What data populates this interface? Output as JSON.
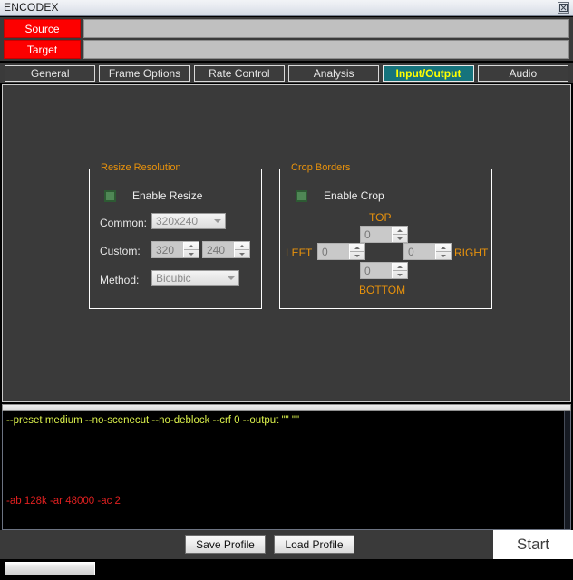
{
  "window": {
    "title": "ENCODEX",
    "close_icon": "close-icon"
  },
  "io": {
    "source_label": "Source",
    "source_value": "",
    "target_label": "Target",
    "target_value": ""
  },
  "tabs": [
    {
      "label": "General",
      "active": false
    },
    {
      "label": "Frame Options",
      "active": false
    },
    {
      "label": "Rate Control",
      "active": false
    },
    {
      "label": "Analysis",
      "active": false
    },
    {
      "label": "Input/Output",
      "active": true
    },
    {
      "label": "Audio",
      "active": false
    }
  ],
  "resize_group": {
    "legend": "Resize Resolution",
    "enable_label": "Enable Resize",
    "enable_checked": true,
    "common_label": "Common:",
    "common_value": "320x240",
    "custom_label": "Custom:",
    "custom_width": "320",
    "custom_height": "240",
    "method_label": "Method:",
    "method_value": "Bicubic"
  },
  "crop_group": {
    "legend": "Crop Borders",
    "enable_label": "Enable Crop",
    "enable_checked": true,
    "top_label": "TOP",
    "bottom_label": "BOTTOM",
    "left_label": "LEFT",
    "right_label": "RIGHT",
    "top_value": "0",
    "bottom_value": "0",
    "left_value": "0",
    "right_value": "0"
  },
  "console": {
    "command_line": "--preset medium --no-scenecut --no-deblock --crf 0 --output \"\" \"\"",
    "audio_line": "-ab 128k -ar 48000 -ac 2"
  },
  "footer": {
    "save_profile": "Save Profile",
    "load_profile": "Load Profile",
    "start": "Start"
  },
  "status": {
    "progress_percent": 0
  },
  "colors": {
    "accent_orange": "#e8920c",
    "active_tab_bg": "#16737c",
    "active_tab_text": "#ffff00",
    "io_button_red": "#fd0000",
    "console_cmd": "#dcf24c",
    "console_audio": "#e02020",
    "panel_bg": "#3a3a3a",
    "checkbox_green": "#4f8755"
  }
}
